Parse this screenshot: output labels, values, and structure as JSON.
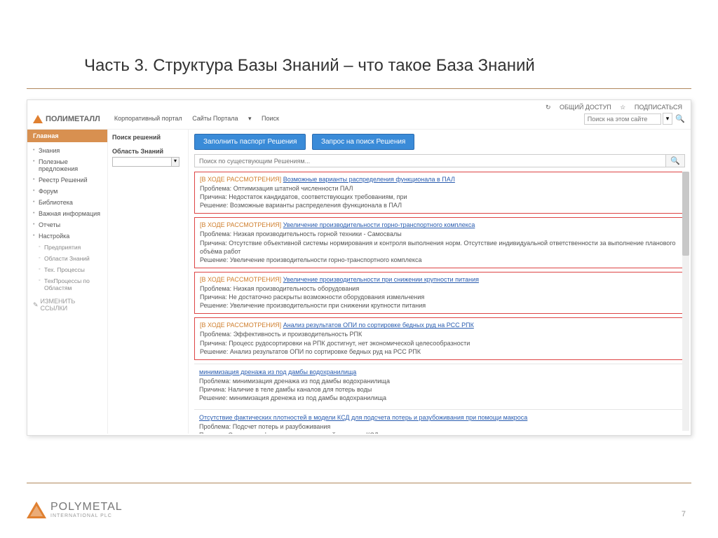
{
  "slide": {
    "title": "Часть 3. Структура Базы Знаний – что такое База Знаний",
    "page_number": "7"
  },
  "top_links": {
    "share": "ОБЩИЙ ДОСТУП",
    "subscribe": "ПОДПИСАТЬСЯ"
  },
  "header": {
    "logo_text": "ПОЛИМЕТАЛЛ",
    "nav": [
      "Корпоративный портал",
      "Сайты Портала",
      "Поиск"
    ],
    "search_placeholder": "Поиск на этом сайте"
  },
  "sidebar": {
    "active": "Главная",
    "items": [
      "Знания",
      "Полезные предложения",
      "Реестр Решений",
      "Форум",
      "Библиотека",
      "Важная информация",
      "Отчеты",
      "Настройка"
    ],
    "sub_items": [
      "Предприятия",
      "Области Знаний",
      "Тех. Процессы",
      "ТехПроцессы по Областям"
    ],
    "edit_links": "ИЗМЕНИТЬ ССЫЛКИ"
  },
  "filter": {
    "header": "Поиск решений",
    "label": "Область Знаний"
  },
  "actions": {
    "fill_passport": "Заполнить паспорт Решения",
    "search_request": "Запрос на поиск Решения"
  },
  "search": {
    "placeholder": "Поиск по существующим Решениям..."
  },
  "field_labels": {
    "problem": "Проблема:",
    "reason": "Причина:",
    "solution": "Решение:"
  },
  "status_label": "[В ХОДЕ РАССМОТРЕНИЯ]",
  "cards": [
    {
      "boxed": true,
      "title": "Возможные варианты распределения функционала в ПАЛ",
      "problem": "Оптимизация штатной численности ПАЛ",
      "reason": "Недостаток кандидатов, соответствующих требованиям, при",
      "solution": "Возможные варианты распределения функционала в ПАЛ"
    },
    {
      "boxed": true,
      "title": "Увеличение производительности горно-транспортного комплекса",
      "problem": "Низкая производительность горной техники - Самосвалы",
      "reason": "Отсутствие объективной системы нормирования и контроля выполнения норм. Отсутствие индивидуальной ответственности за выполнение планового объёма работ",
      "solution": "Увеличение производительности горно-транспортного комплекса"
    },
    {
      "boxed": true,
      "title": "Увеличение производительности при снижении крупности питания",
      "problem": "Низкая производительность оборудования",
      "reason": "Не достаточно раскрыты возможности оборудования измельчения",
      "solution": "Увеличение производительности при снижении крупности питания"
    },
    {
      "boxed": true,
      "title": "Анализ результатов ОПИ по сортировке бедных руд на РСС РПК",
      "problem": "Эффективность и производительность РПК",
      "reason": "Процесс рудосортировки на РПК достигнут, нет экономической целесообразности",
      "solution": "Анализ результатов ОПИ по сортировке бедных руд на РСС РПК"
    },
    {
      "boxed": false,
      "title": "минимизация дренажа из под дамбы водохранилища",
      "problem": "минимизация дренажа из под дамбы водохранилища",
      "reason": "Наличие в теле дамбы каналов для потерь воды",
      "solution": "минимизация дренежа из под дамбы водохранилища"
    },
    {
      "boxed": false,
      "title": "Отсутствие фактических плотностей в модели КСД для подсчета потерь и разубоживания при помощи макроса",
      "problem": "Подсчет потерь и разубоживания",
      "reason": "Отсутствие фактических плотностей в модели КСД",
      "solution": ""
    }
  ],
  "footer_logo": {
    "main": "POLYMETAL",
    "sub": "INTERNATIONAL PLC"
  }
}
